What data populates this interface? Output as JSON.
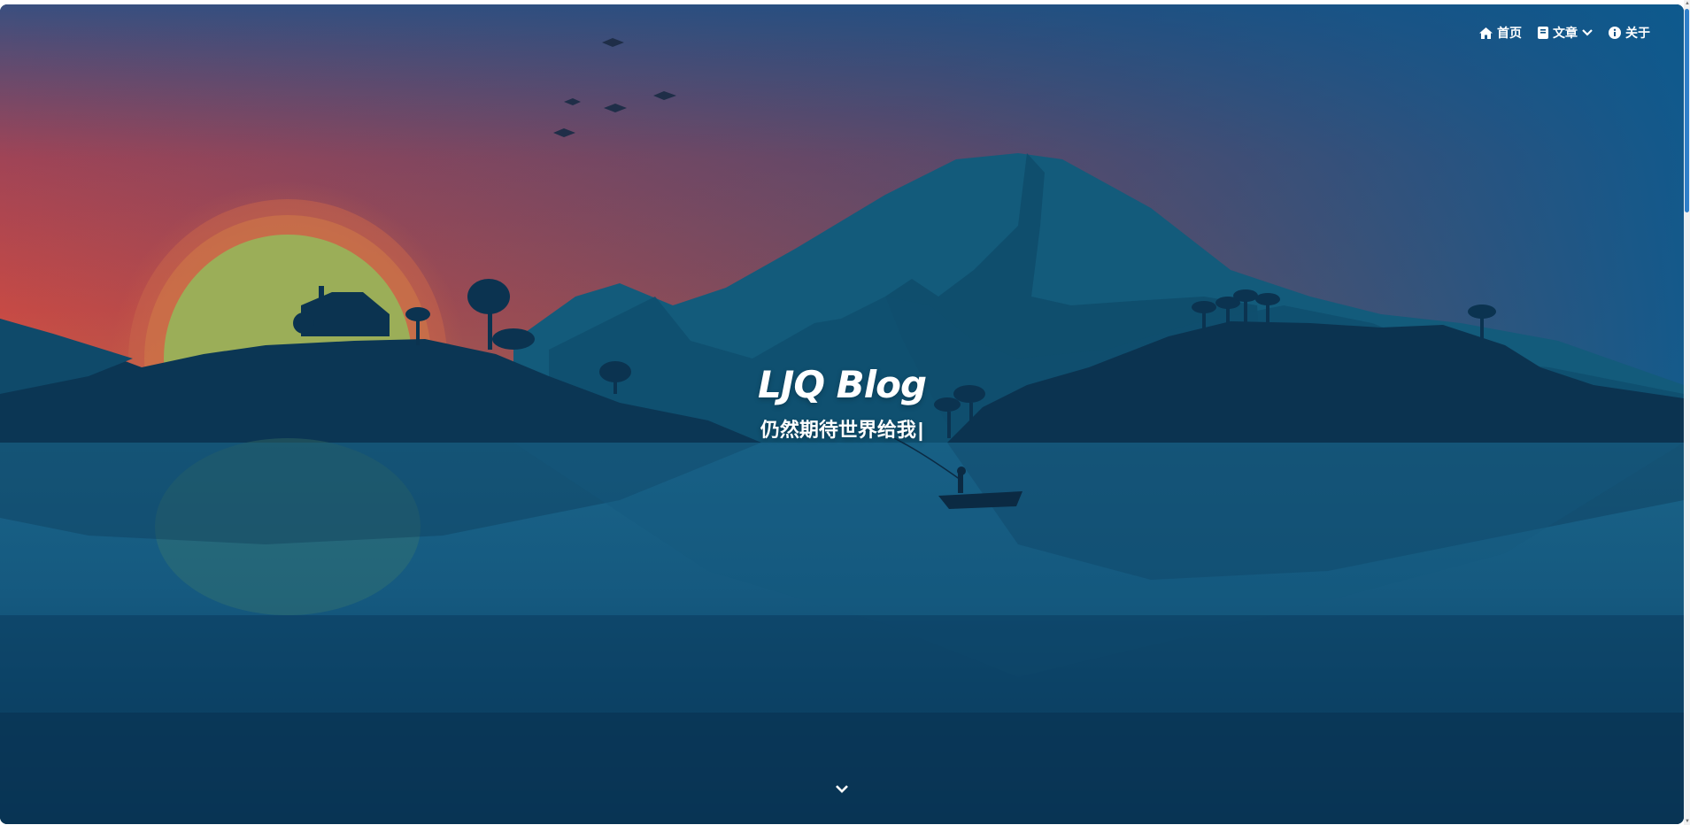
{
  "nav": {
    "items": [
      {
        "label": "首页",
        "icon": "home-icon"
      },
      {
        "label": "文章",
        "icon": "book-icon",
        "dropdown": true
      },
      {
        "label": "关于",
        "icon": "info-icon"
      }
    ]
  },
  "hero": {
    "title": "LJQ Blog",
    "subtitle": "仍然期待世界给我",
    "cursor": "|"
  },
  "scroll_down_icon": "chevron-down-icon",
  "colors": {
    "sky_top": "#0b4f82",
    "sky_sunset": "#c64a45",
    "sun": "#9bae58",
    "mountain": "#125a7a",
    "island": "#0b3350",
    "water": "#0e4d72",
    "scrollbar_thumb": "#2f7fc9"
  }
}
